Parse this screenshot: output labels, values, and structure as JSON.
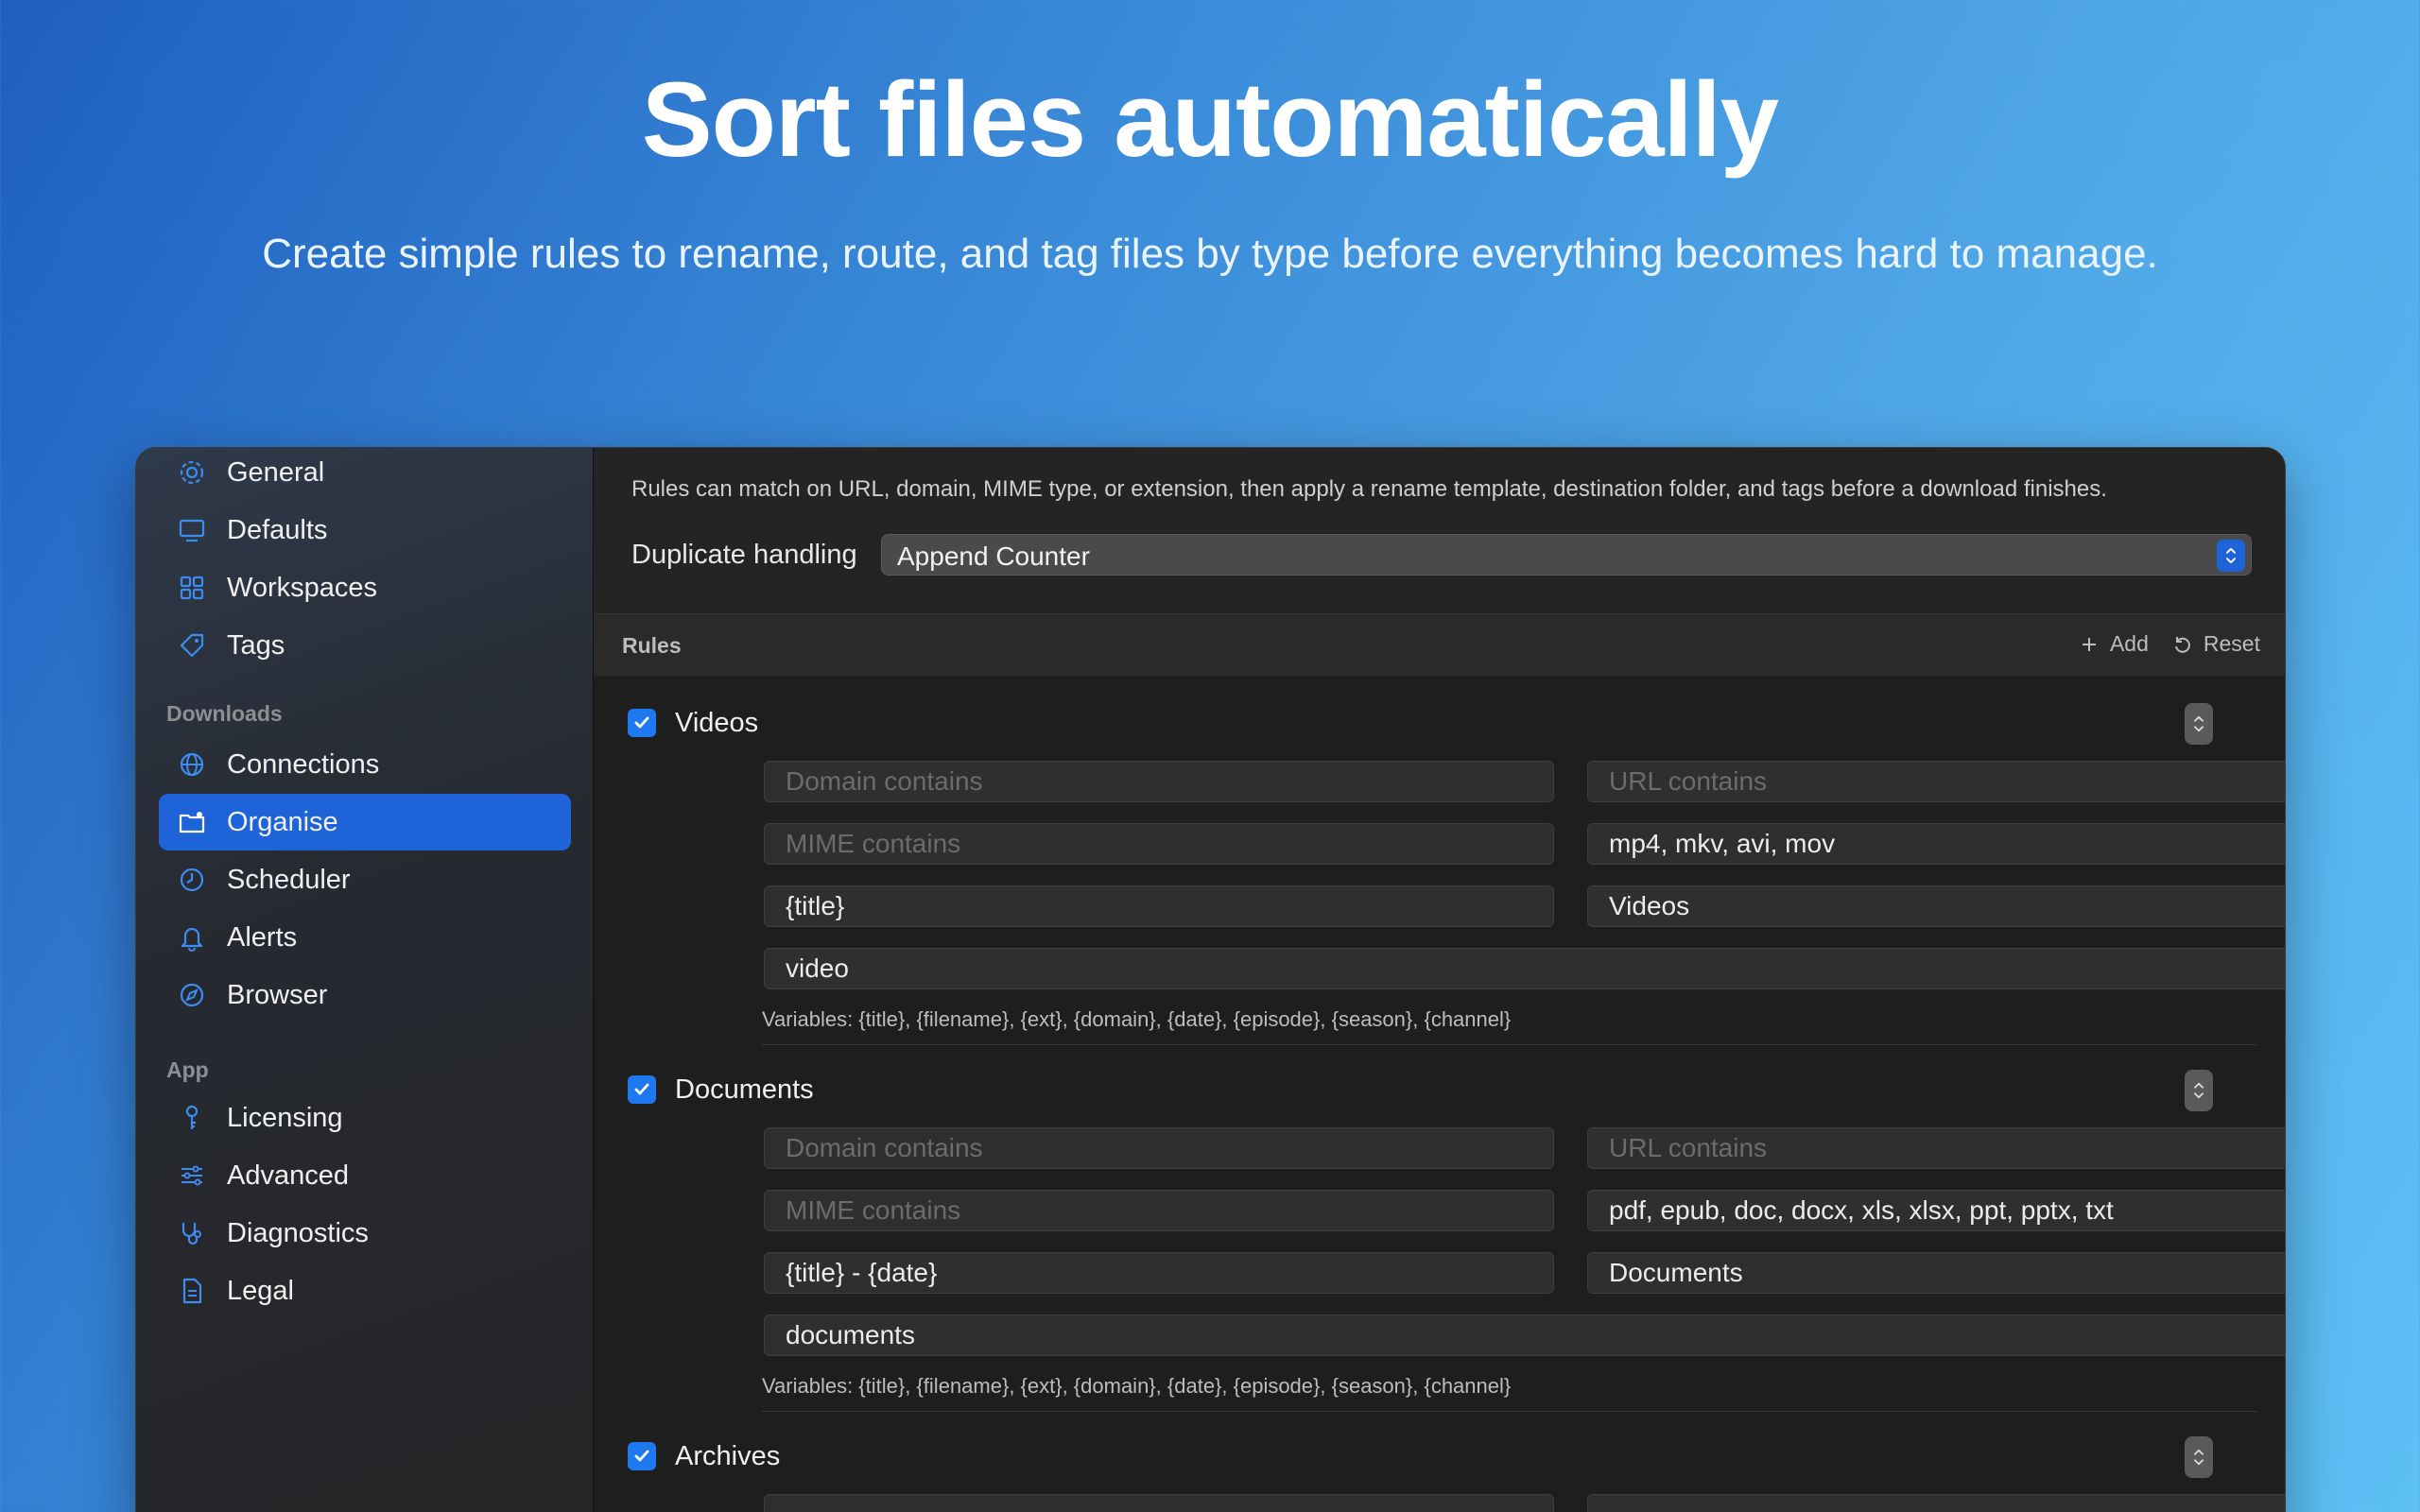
{
  "hero": {
    "title": "Sort files automatically",
    "subtitle": "Create simple rules to rename, route, and tag files by type before everything becomes hard to manage."
  },
  "sidebar": {
    "items_top": [
      {
        "label": "General",
        "icon": "gear-icon"
      },
      {
        "label": "Defaults",
        "icon": "monitor-icon"
      },
      {
        "label": "Workspaces",
        "icon": "grid-icon"
      },
      {
        "label": "Tags",
        "icon": "tag-icon"
      }
    ],
    "section_downloads": "Downloads",
    "items_downloads": [
      {
        "label": "Connections",
        "icon": "globe-icon"
      },
      {
        "label": "Organise",
        "icon": "folder-gear-icon",
        "active": true
      },
      {
        "label": "Scheduler",
        "icon": "clock-icon"
      },
      {
        "label": "Alerts",
        "icon": "bell-icon"
      },
      {
        "label": "Browser",
        "icon": "compass-icon"
      }
    ],
    "section_app": "App",
    "items_app": [
      {
        "label": "Licensing",
        "icon": "key-icon"
      },
      {
        "label": "Advanced",
        "icon": "sliders-icon"
      },
      {
        "label": "Diagnostics",
        "icon": "stethoscope-icon"
      },
      {
        "label": "Legal",
        "icon": "document-icon"
      }
    ]
  },
  "main": {
    "description": "Rules can match on URL, domain, MIME type, or extension, then apply a rename template, destination folder, and tags before a download finishes.",
    "duplicate_label": "Duplicate handling",
    "duplicate_value": "Append Counter",
    "rules_title": "Rules",
    "add_label": "Add",
    "reset_label": "Reset",
    "rules": [
      {
        "name": "Videos",
        "enabled": true,
        "domain_placeholder": "Domain contains",
        "url_placeholder": "URL contains",
        "mime_placeholder": "MIME contains",
        "extensions": "mp4, mkv, avi, mov",
        "template": "{title}",
        "folder": "Videos",
        "tags": "video",
        "variables": "Variables: {title}, {filename}, {ext}, {domain}, {date}, {episode}, {season}, {channel}"
      },
      {
        "name": "Documents",
        "enabled": true,
        "domain_placeholder": "Domain contains",
        "url_placeholder": "URL contains",
        "mime_placeholder": "MIME contains",
        "extensions": "pdf, epub, doc, docx, xls, xlsx, ppt, pptx, txt",
        "template": "{title} - {date}",
        "folder": "Documents",
        "tags": "documents",
        "variables": "Variables: {title}, {filename}, {ext}, {domain}, {date}, {episode}, {season}, {channel}"
      },
      {
        "name": "Archives",
        "enabled": true
      }
    ]
  },
  "colors": {
    "accent": "#1e63d8",
    "checkbox": "#1e78f0",
    "icon_blue": "#3d8cf0"
  }
}
